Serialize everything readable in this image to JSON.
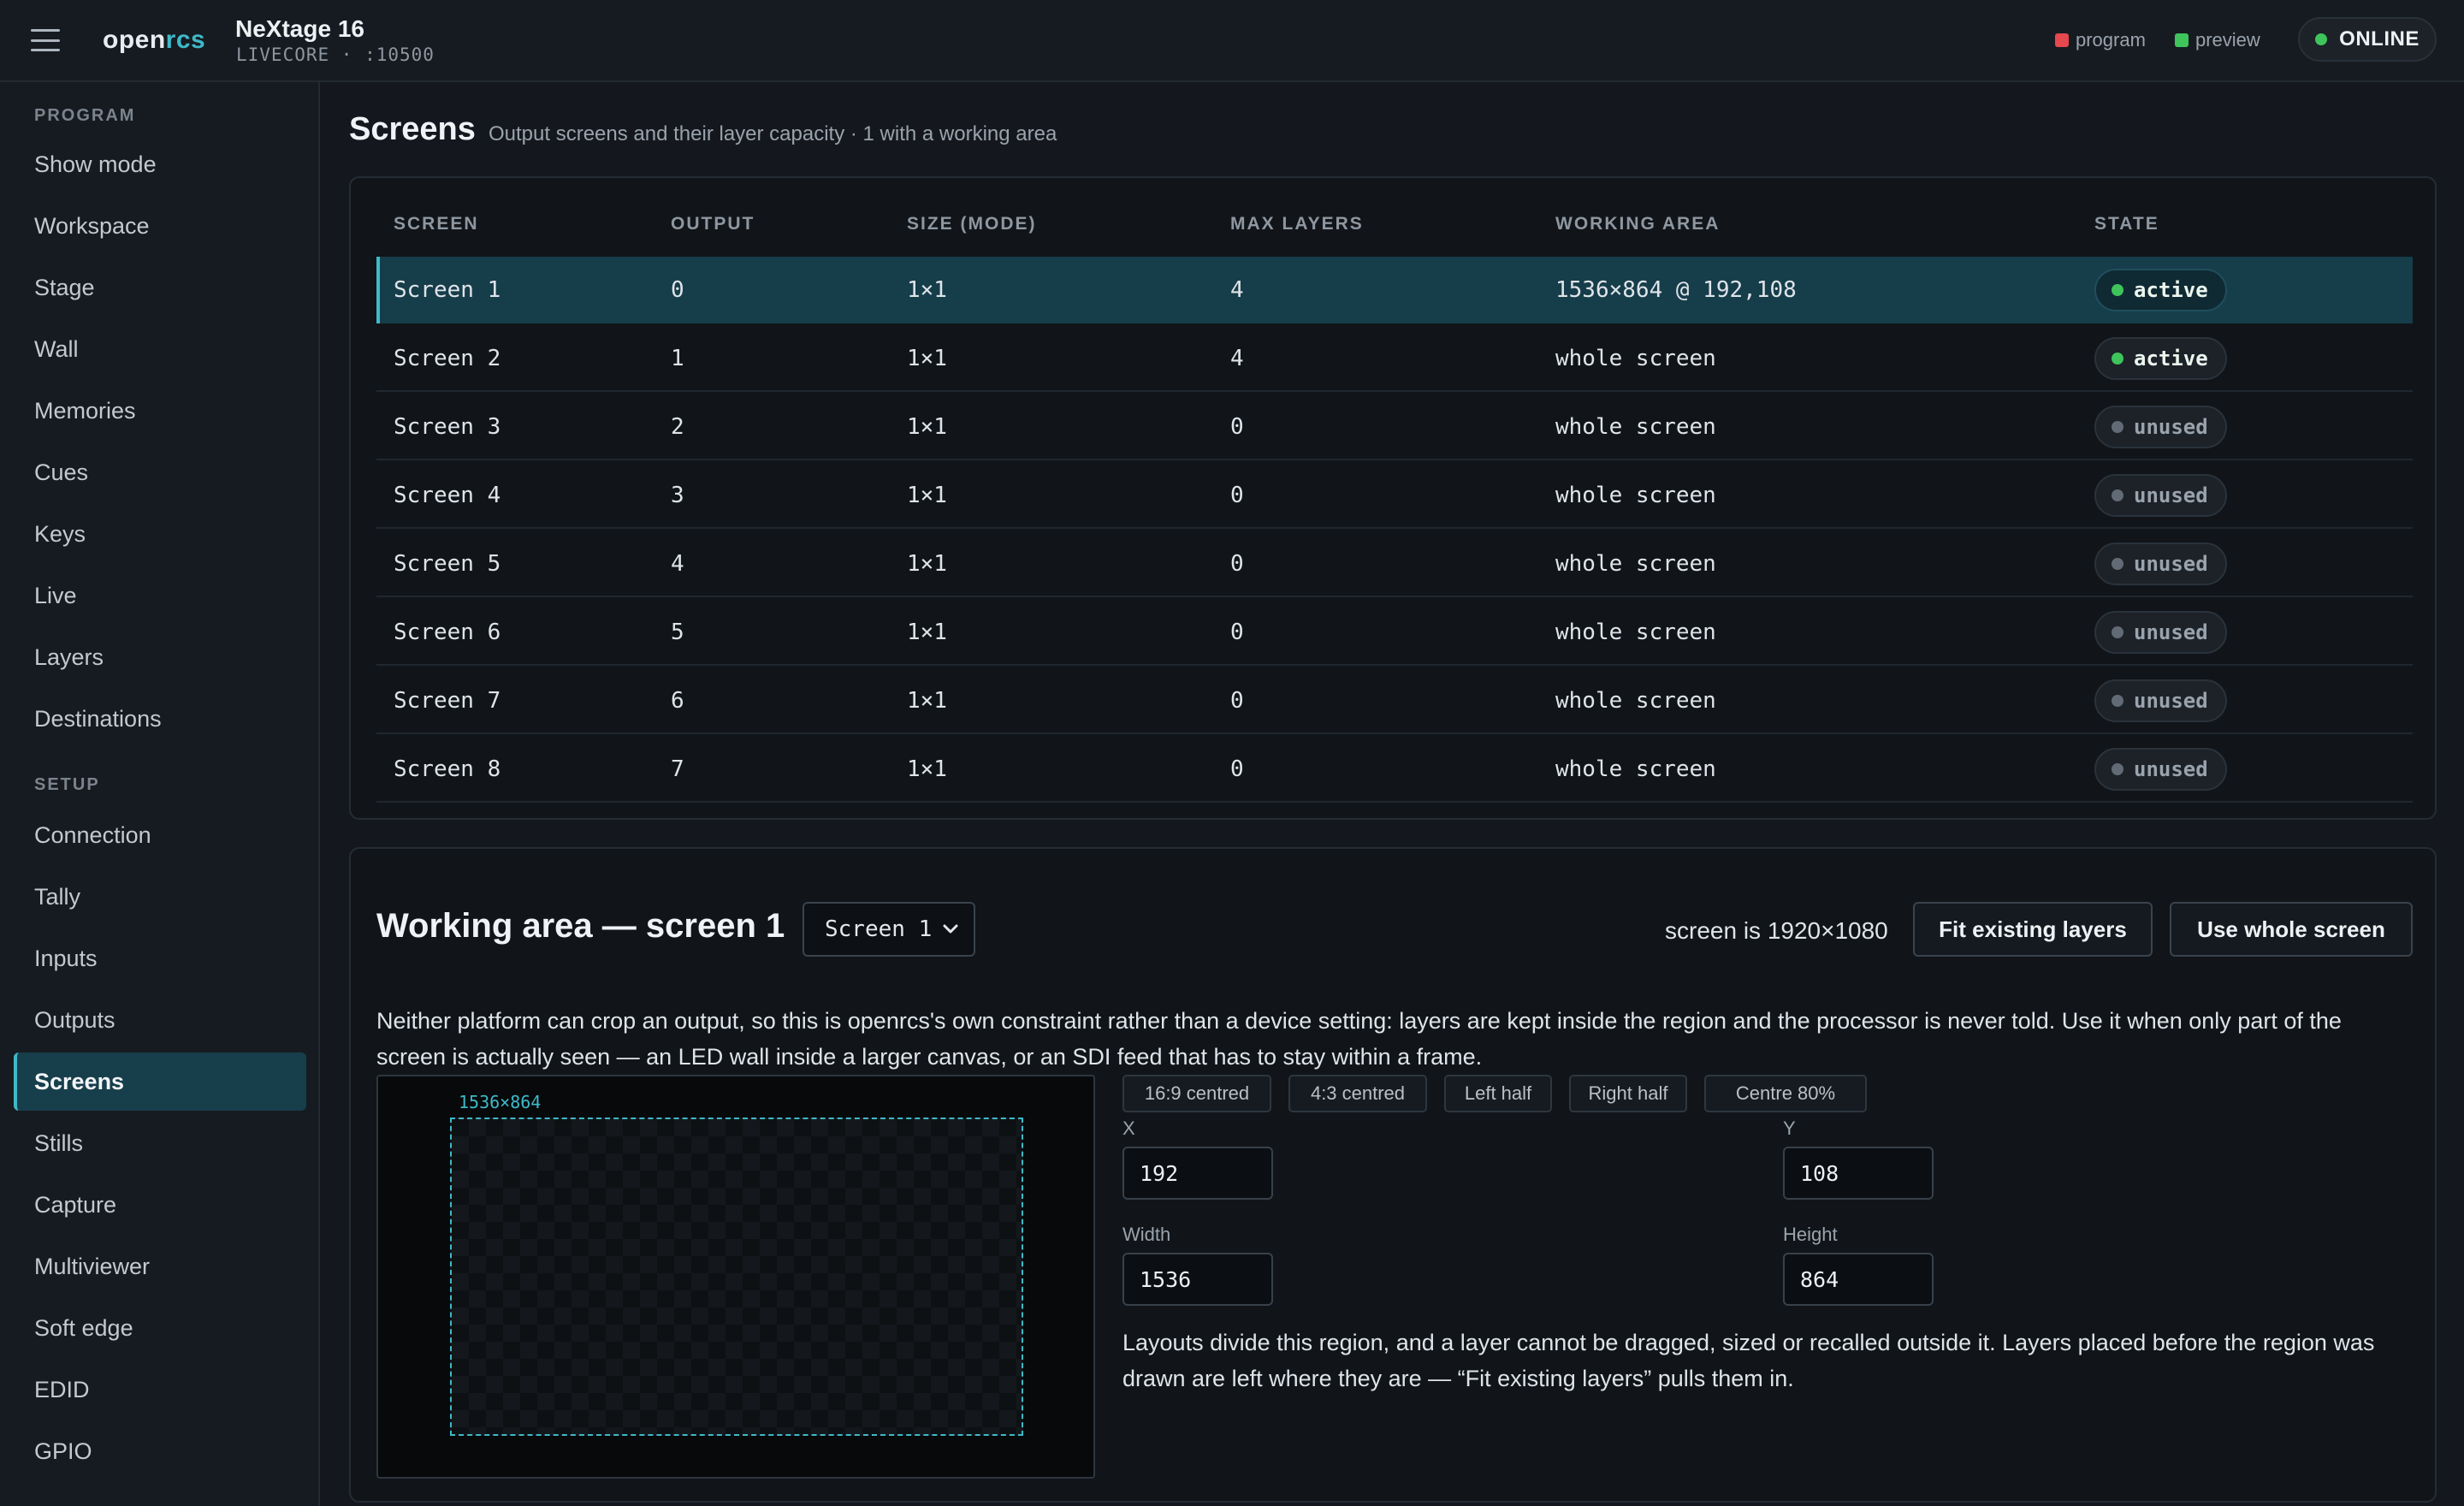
{
  "brand": {
    "part1": "open",
    "part2": "rcs"
  },
  "header": {
    "title": "NeXtage 16",
    "subtitle": "LIVECORE · :10500",
    "legend_program": "program",
    "legend_preview": "preview",
    "status": "ONLINE",
    "colors": {
      "program": "#e5484d",
      "preview": "#3ec45b",
      "online": "#3ec45b",
      "accent": "#3fb9c8"
    }
  },
  "sidebar": {
    "program_heading": "PROGRAM",
    "program_items": [
      "Show mode",
      "Workspace",
      "Stage",
      "Wall",
      "Memories",
      "Cues",
      "Keys",
      "Live",
      "Layers",
      "Destinations"
    ],
    "setup_heading": "SETUP",
    "setup_items": [
      "Connection",
      "Tally",
      "Inputs",
      "Outputs",
      "Screens",
      "Stills",
      "Capture",
      "Multiviewer",
      "Soft edge",
      "EDID",
      "GPIO"
    ],
    "active_item": "Screens"
  },
  "page": {
    "title": "Screens",
    "description": "Output screens and their layer capacity · 1 with a working area"
  },
  "table": {
    "columns": [
      "SCREEN",
      "OUTPUT",
      "SIZE (MODE)",
      "MAX LAYERS",
      "WORKING AREA",
      "STATE"
    ],
    "rows": [
      {
        "screen": "Screen 1",
        "output": "0",
        "size": "1×1",
        "max_layers": "4",
        "working_area": "1536×864 @ 192,108",
        "state": "active"
      },
      {
        "screen": "Screen 2",
        "output": "1",
        "size": "1×1",
        "max_layers": "4",
        "working_area": "whole screen",
        "state": "active"
      },
      {
        "screen": "Screen 3",
        "output": "2",
        "size": "1×1",
        "max_layers": "0",
        "working_area": "whole screen",
        "state": "unused"
      },
      {
        "screen": "Screen 4",
        "output": "3",
        "size": "1×1",
        "max_layers": "0",
        "working_area": "whole screen",
        "state": "unused"
      },
      {
        "screen": "Screen 5",
        "output": "4",
        "size": "1×1",
        "max_layers": "0",
        "working_area": "whole screen",
        "state": "unused"
      },
      {
        "screen": "Screen 6",
        "output": "5",
        "size": "1×1",
        "max_layers": "0",
        "working_area": "whole screen",
        "state": "unused"
      },
      {
        "screen": "Screen 7",
        "output": "6",
        "size": "1×1",
        "max_layers": "0",
        "working_area": "whole screen",
        "state": "unused"
      },
      {
        "screen": "Screen 8",
        "output": "7",
        "size": "1×1",
        "max_layers": "0",
        "working_area": "whole screen",
        "state": "unused"
      }
    ]
  },
  "working_area": {
    "title": "Working area — screen 1",
    "selected_screen": "Screen 1",
    "screen_size_text": "screen is 1920×1080",
    "fit_button": "Fit existing layers",
    "whole_button": "Use whole screen",
    "description": "Neither platform can crop an output, so this is openrcs's own constraint rather than a device setting: layers are kept inside the region and the processor is never told. Use it when only part of the screen is actually seen — an LED wall inside a larger canvas, or an SDI feed that has to stay within a frame.",
    "region_label": "1536×864",
    "presets": [
      "16:9 centred",
      "4:3 centred",
      "Left half",
      "Right half",
      "Centre 80%"
    ],
    "x_label": "X",
    "x_value": "192",
    "y_label": "Y",
    "y_value": "108",
    "width_label": "Width",
    "width_value": "1536",
    "height_label": "Height",
    "height_value": "864",
    "note": "Layouts divide this region, and a layer cannot be dragged, sized or recalled outside it. Layers placed before the region was drawn are left where they are — “Fit existing layers” pulls them in."
  }
}
